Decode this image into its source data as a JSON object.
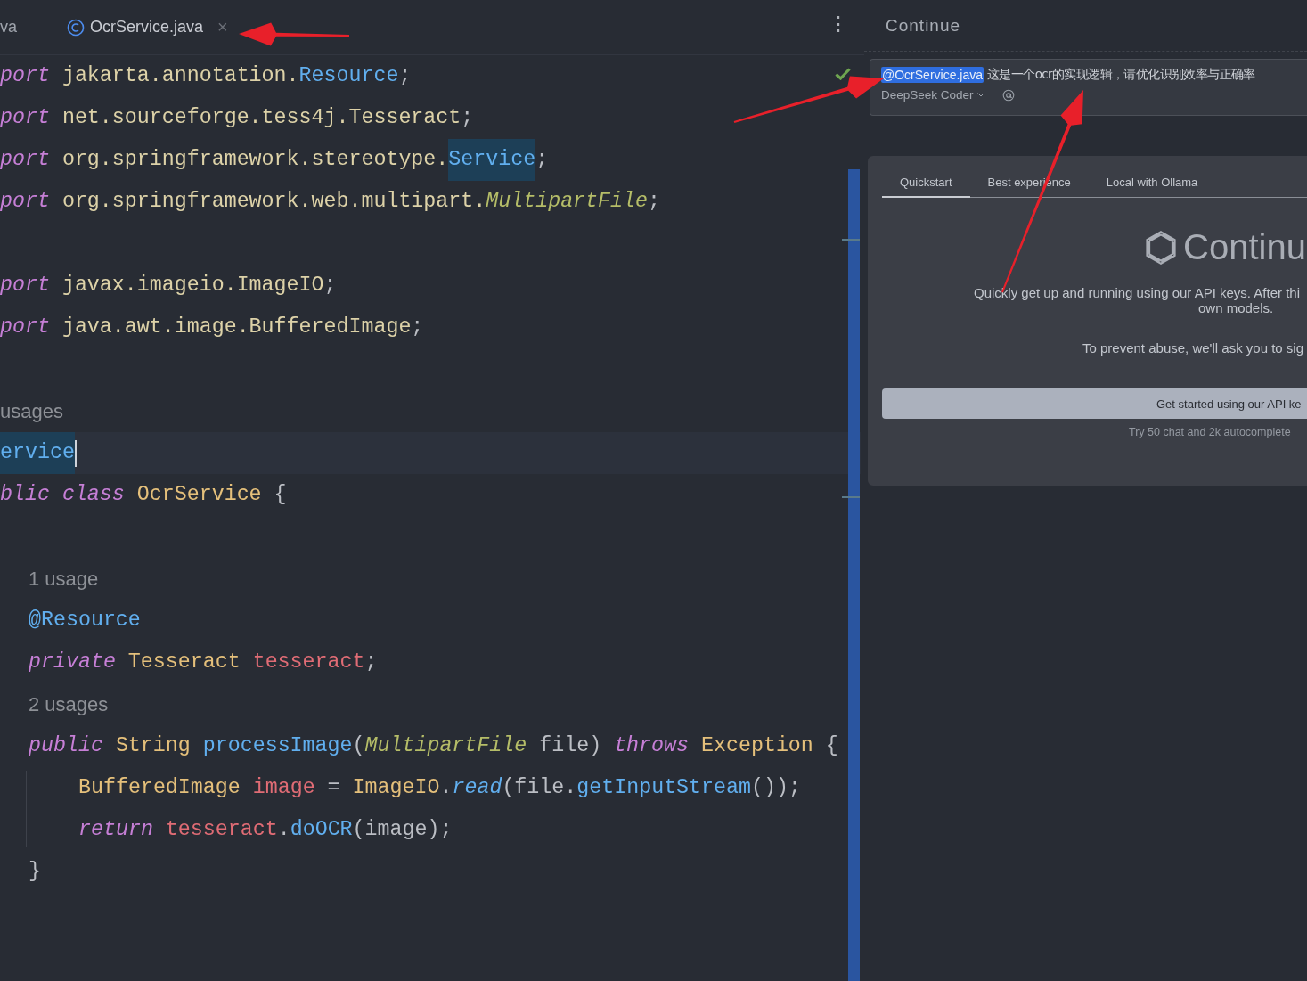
{
  "editor": {
    "tabs": [
      {
        "label": "va",
        "selected": false
      },
      {
        "label": "OcrService.java",
        "selected": true,
        "close_glyph": "×"
      }
    ],
    "more_glyph": "⋮",
    "lines": [
      {
        "kind": "code",
        "current": false,
        "tokens": [
          {
            "kind": "keyword",
            "text": "port "
          },
          {
            "kind": "package",
            "text": "jakarta.annotation."
          },
          {
            "kind": "reference",
            "text": "Resource"
          },
          {
            "kind": "plain",
            "text": ";"
          }
        ]
      },
      {
        "kind": "code",
        "current": false,
        "tokens": [
          {
            "kind": "keyword",
            "text": "port "
          },
          {
            "kind": "package",
            "text": "net.sourceforge.tess4j.Tesseract"
          },
          {
            "kind": "plain",
            "text": ";"
          }
        ]
      },
      {
        "kind": "code",
        "current": false,
        "tokens": [
          {
            "kind": "keyword",
            "text": "port "
          },
          {
            "kind": "package",
            "text": "org.springframework.stereotype."
          },
          {
            "kind": "usage-mark",
            "text": "Service"
          },
          {
            "kind": "plain",
            "text": ";"
          }
        ]
      },
      {
        "kind": "code",
        "current": false,
        "tokens": [
          {
            "kind": "keyword",
            "text": "port "
          },
          {
            "kind": "package",
            "text": "org.springframework.web.multipart."
          },
          {
            "kind": "interface",
            "text": "MultipartFile"
          },
          {
            "kind": "plain",
            "text": ";"
          }
        ]
      },
      {
        "kind": "blank"
      },
      {
        "kind": "code",
        "current": false,
        "tokens": [
          {
            "kind": "keyword",
            "text": "port "
          },
          {
            "kind": "package",
            "text": "javax.imageio.ImageIO"
          },
          {
            "kind": "plain",
            "text": ";"
          }
        ]
      },
      {
        "kind": "code",
        "current": false,
        "tokens": [
          {
            "kind": "keyword",
            "text": "port "
          },
          {
            "kind": "package",
            "text": "java.awt.image.BufferedImage"
          },
          {
            "kind": "plain",
            "text": ";"
          }
        ]
      },
      {
        "kind": "blank"
      },
      {
        "kind": "hint",
        "text": "usages"
      },
      {
        "kind": "code",
        "current": true,
        "tokens": [
          {
            "kind": "usage-mark",
            "text": "ervice"
          }
        ]
      },
      {
        "kind": "code",
        "current": false,
        "tokens": [
          {
            "kind": "keyword",
            "text": "blic class "
          },
          {
            "kind": "class",
            "text": "OcrService"
          },
          {
            "kind": "plain",
            "text": " {"
          }
        ],
        "children": [
          {
            "kind": "blank"
          },
          {
            "kind": "hint",
            "text": "1 usage"
          },
          {
            "kind": "code",
            "current": false,
            "tokens": [
              {
                "kind": "annotation",
                "text": "@Resource"
              }
            ]
          },
          {
            "kind": "code",
            "current": false,
            "tokens": [
              {
                "kind": "keyword",
                "text": "private "
              },
              {
                "kind": "class",
                "text": "Tesseract "
              },
              {
                "kind": "field",
                "text": "tesseract"
              },
              {
                "kind": "plain",
                "text": ";"
              }
            ]
          },
          {
            "kind": "hint",
            "text": "2 usages"
          },
          {
            "kind": "code",
            "current": false,
            "tokens": [
              {
                "kind": "keyword",
                "text": "public "
              },
              {
                "kind": "class",
                "text": "String "
              },
              {
                "kind": "method",
                "text": "processImage"
              },
              {
                "kind": "plain",
                "text": "("
              },
              {
                "kind": "interface",
                "text": "MultipartFile"
              },
              {
                "kind": "plain",
                "text": " file) "
              },
              {
                "kind": "keyword",
                "text": "throws "
              },
              {
                "kind": "class",
                "text": "Exception"
              },
              {
                "kind": "plain",
                "text": " {"
              }
            ],
            "children": [
              {
                "kind": "code",
                "current": false,
                "tokens": [
                  {
                    "kind": "class",
                    "text": "BufferedImage "
                  },
                  {
                    "kind": "field",
                    "text": "image"
                  },
                  {
                    "kind": "plain",
                    "text": " = "
                  },
                  {
                    "kind": "class",
                    "text": "ImageIO"
                  },
                  {
                    "kind": "plain",
                    "text": "."
                  },
                  {
                    "kind": "static-method",
                    "text": "read"
                  },
                  {
                    "kind": "plain",
                    "text": "(file."
                  },
                  {
                    "kind": "method",
                    "text": "getInputStream"
                  },
                  {
                    "kind": "plain",
                    "text": "());"
                  }
                ]
              },
              {
                "kind": "code",
                "current": false,
                "tokens": [
                  {
                    "kind": "keyword",
                    "text": "return "
                  },
                  {
                    "kind": "field",
                    "text": "tesseract"
                  },
                  {
                    "kind": "plain",
                    "text": "."
                  },
                  {
                    "kind": "method",
                    "text": "doOCR"
                  },
                  {
                    "kind": "plain",
                    "text": "(image);"
                  }
                ]
              }
            ]
          },
          {
            "kind": "code",
            "current": false,
            "tokens": [
              {
                "kind": "plain",
                "text": "}"
              }
            ]
          }
        ]
      }
    ]
  },
  "continue_panel": {
    "title": "Continue",
    "input": {
      "mention": "@OcrService.java",
      "text": "这是一个ocr的实现逻辑，请优化识别效率与正确率",
      "model": "DeepSeek Coder"
    },
    "tabs": [
      {
        "label": "Quickstart",
        "selected": true
      },
      {
        "label": "Best experience",
        "selected": false
      },
      {
        "label": "Local with Ollama",
        "selected": false
      }
    ],
    "logo_text": "Continu",
    "description": [
      "Quickly get up and running using our API keys. After thi",
      "own models."
    ],
    "notice": "To prevent abuse, we'll ask you to sig",
    "button": "Get started using our API ke",
    "footnote": "Try 50 chat and 2k autocomplete"
  }
}
